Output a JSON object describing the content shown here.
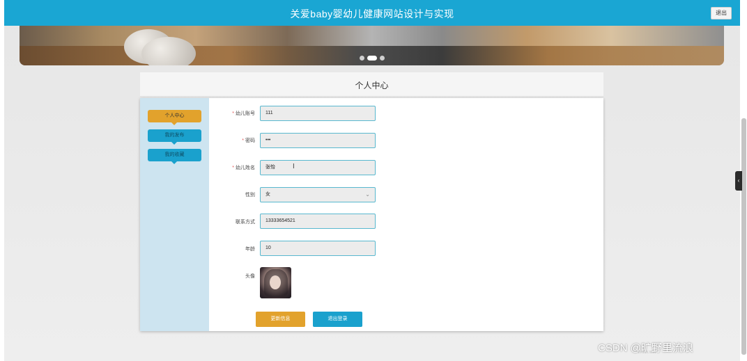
{
  "header": {
    "title": "关爱baby婴幼儿健康网站设计与实现",
    "logout_label": "退出"
  },
  "carousel": {
    "dot_count": 3,
    "active_index": 1
  },
  "panel": {
    "title": "个人中心"
  },
  "sidebar": {
    "items": [
      {
        "label": "个人中心",
        "active": true
      },
      {
        "label": "我的发布",
        "active": false
      },
      {
        "label": "我的收藏",
        "active": false
      }
    ]
  },
  "form": {
    "fields": [
      {
        "label": "幼儿账号",
        "required": true,
        "value": "111"
      },
      {
        "label": "密码",
        "required": true,
        "value": "•••"
      },
      {
        "label": "幼儿姓名",
        "required": true,
        "value": "张怡"
      },
      {
        "label": "性别",
        "required": false,
        "value": "女",
        "type": "select"
      },
      {
        "label": "联系方式",
        "required": false,
        "value": "13333654521"
      },
      {
        "label": "年龄",
        "required": false,
        "value": "10"
      }
    ],
    "avatar_label": "头像",
    "update_button": "更新信息",
    "logout_button": "退出登录"
  },
  "watermark": {
    "text": "CSDN @旷野里流浪",
    "faint_text": "www.ww"
  },
  "colors": {
    "topbar": "#1aa6d3",
    "accent_orange": "#e2a22c",
    "accent_blue": "#1aa1cd",
    "sidebar_bg": "#cde4f0"
  }
}
